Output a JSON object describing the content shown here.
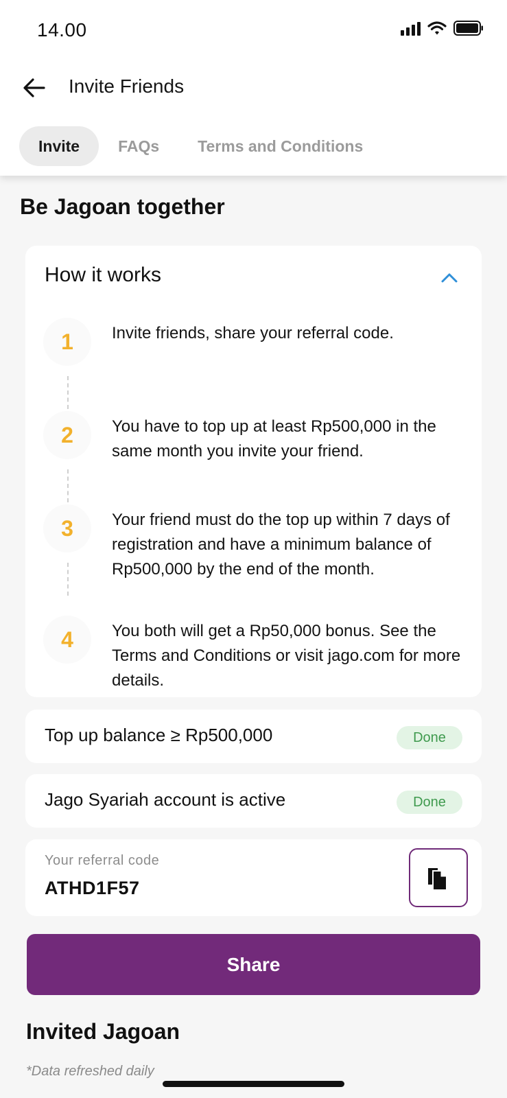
{
  "status_bar": {
    "time": "14.00"
  },
  "header": {
    "title": "Invite Friends"
  },
  "tabs": [
    {
      "label": "Invite",
      "active": true
    },
    {
      "label": "FAQs",
      "active": false
    },
    {
      "label": "Terms and Conditions",
      "active": false
    }
  ],
  "section_title": "Be Jagoan together",
  "how_it_works": {
    "title": "How it works",
    "expanded": true,
    "steps": [
      {
        "number": "1",
        "text": "Invite friends, share your referral code."
      },
      {
        "number": "2",
        "text": "You have to top up at least Rp500,000 in the same month you invite your friend."
      },
      {
        "number": "3",
        "text": "Your friend must do the top up within 7 days of registration and have a minimum balance of Rp500,000 by the end of the month."
      },
      {
        "number": "4",
        "text": "You both will get a Rp50,000 bonus. See the Terms and Conditions or visit jago.com for more details."
      }
    ]
  },
  "requirements": [
    {
      "label": "Top up balance ≥ Rp500,000",
      "status": "Done"
    },
    {
      "label": "Jago Syariah account is active",
      "status": "Done"
    }
  ],
  "referral": {
    "label": "Your referral code",
    "code": "ATHD1F57"
  },
  "share_label": "Share",
  "invited": {
    "title": "Invited Jagoan",
    "note": "*Data refreshed daily"
  },
  "colors": {
    "brand": "#722a7a",
    "step_number": "#f2b12c",
    "done_bg": "#e3f4e5",
    "done_text": "#3f9a4e",
    "chevron": "#2f8fd8"
  }
}
